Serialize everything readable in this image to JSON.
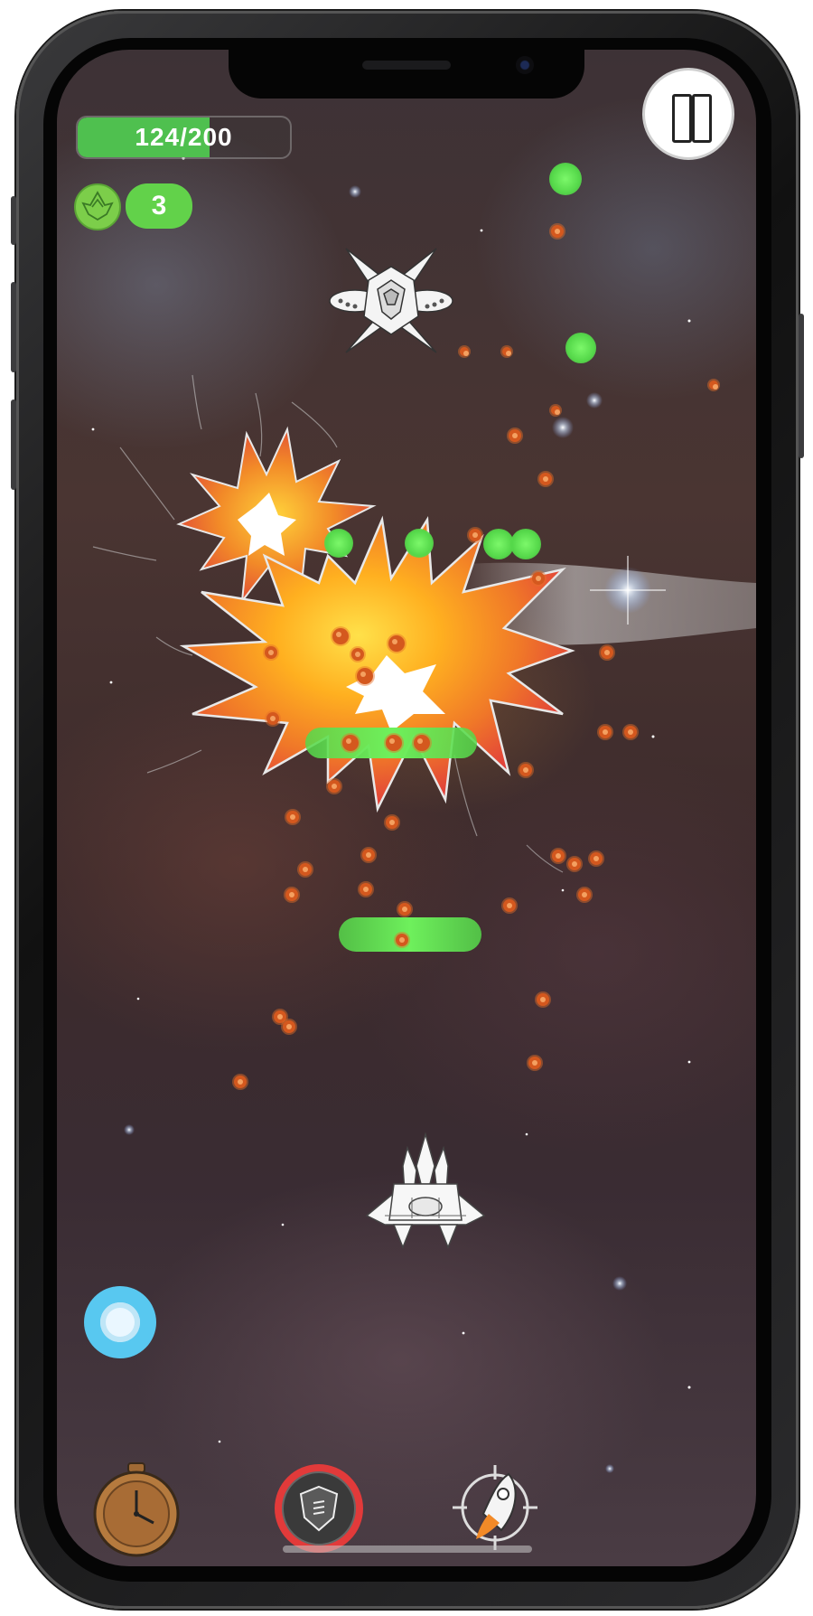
{
  "hud": {
    "health_text": "124/200",
    "health_fraction": 0.62,
    "lives_count": "3"
  },
  "controls": {
    "pause_icon": "pause-icon",
    "shield_icon": "shield-ring-icon",
    "powerups": [
      "stopwatch-icon",
      "armor-shield-icon",
      "rocket-target-icon"
    ]
  },
  "colors": {
    "health_green": "#4fc04f",
    "orb_green": "#55d84a",
    "enemy_bullet": "#d4581e",
    "shield_blue": "#58c8f0"
  }
}
